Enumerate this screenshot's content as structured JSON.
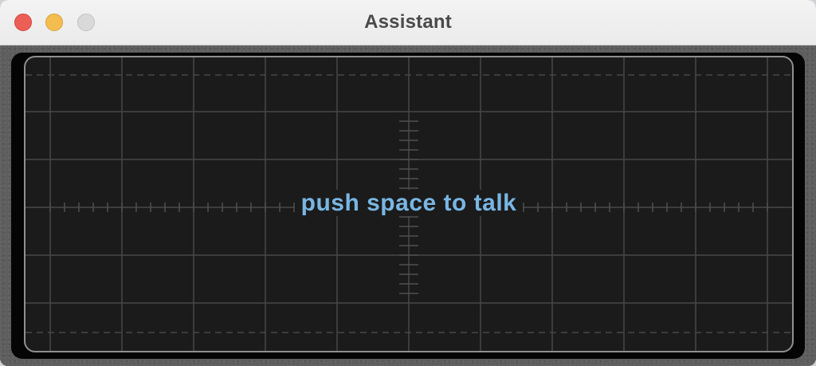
{
  "window": {
    "title": "Assistant",
    "controls": [
      "close",
      "minimize",
      "zoom"
    ]
  },
  "oscilloscope": {
    "prompt": "push space to talk",
    "prompt_color": "#79b6e3",
    "background_color": "#1b1b1b",
    "grid_color": "#4a4a4a"
  }
}
